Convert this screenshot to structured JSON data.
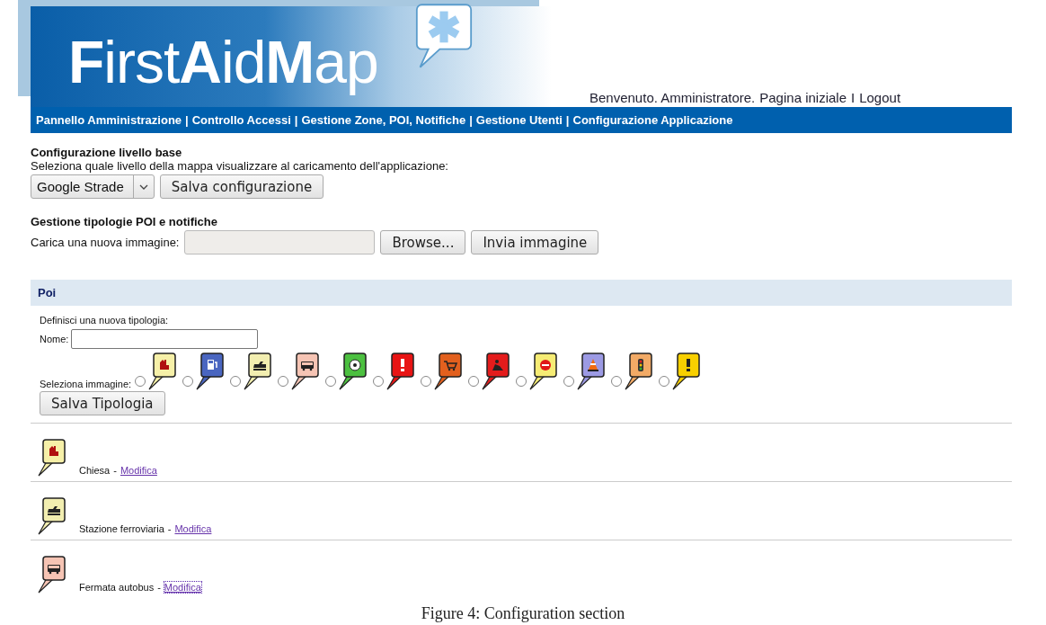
{
  "header": {
    "logo": "**F**irst**A**id**M**ap",
    "user_links": [
      {
        "label": "Benvenuto. Amministratore."
      },
      {
        "label": "Pagina iniziale"
      },
      {
        "label": "Logout"
      }
    ],
    "user_separator": "I"
  },
  "nav": {
    "items": [
      "Pannello Amministrazione",
      "Controllo Accessi",
      "Gestione Zone, POI, Notifiche",
      "Gestione Utenti",
      "Configurazione Applicazione"
    ],
    "separator": "|"
  },
  "base_layer": {
    "title": "Configurazione livello base",
    "description": "Seleziona quale livello della mappa visualizzare al caricamento dell'applicazione:",
    "select": "Google Strade",
    "button": "Salva configurazione"
  },
  "poi_types": {
    "title": "Gestione tipologie POI e notifiche",
    "upload_label": "Carica una nuova immagine:",
    "browse_button": "Browse...",
    "send_button": "Invia immagine"
  },
  "poi_panel": {
    "header": "Poi",
    "define_label": "Definisci una nuova tipologia:",
    "name_label": "Nome:",
    "image_label": "Seleziona immagine:",
    "save_button": "Salva Tipologia",
    "images": [
      {
        "kind": "church",
        "color": "#f6f0a8",
        "selected": false
      },
      {
        "kind": "fuel",
        "color": "#4a66c0",
        "selected": false
      },
      {
        "kind": "train",
        "color": "#f2eeb0",
        "selected": false
      },
      {
        "kind": "bus",
        "color": "#f6c4b4",
        "selected": false
      },
      {
        "kind": "ball",
        "color": "#4cc040",
        "selected": false
      },
      {
        "kind": "alert",
        "color": "#e81414",
        "selected": false
      },
      {
        "kind": "cart",
        "color": "#e2601e",
        "selected": false
      },
      {
        "kind": "worker",
        "color": "#e41c1c",
        "selected": false
      },
      {
        "kind": "noentry",
        "color": "#f6ec74",
        "selected": false
      },
      {
        "kind": "cone",
        "color": "#9c9ae4",
        "selected": false
      },
      {
        "kind": "light",
        "color": "#f2aa66",
        "selected": false
      },
      {
        "kind": "alert",
        "color": "#f8d000",
        "selected": false
      }
    ],
    "types": [
      {
        "name": "Chiesa",
        "link": "Modifica",
        "kind": "church",
        "color": "#f6f0a8",
        "focused": false
      },
      {
        "name": "Stazione ferroviaria",
        "link": "Modifica",
        "kind": "train",
        "color": "#f2eeb0",
        "focused": false
      },
      {
        "name": "Fermata autobus",
        "link": "Modifica",
        "kind": "bus",
        "color": "#f6c4b4",
        "focused": true
      }
    ],
    "type_separator": "-"
  },
  "caption": "Figure 4: Configuration section"
}
